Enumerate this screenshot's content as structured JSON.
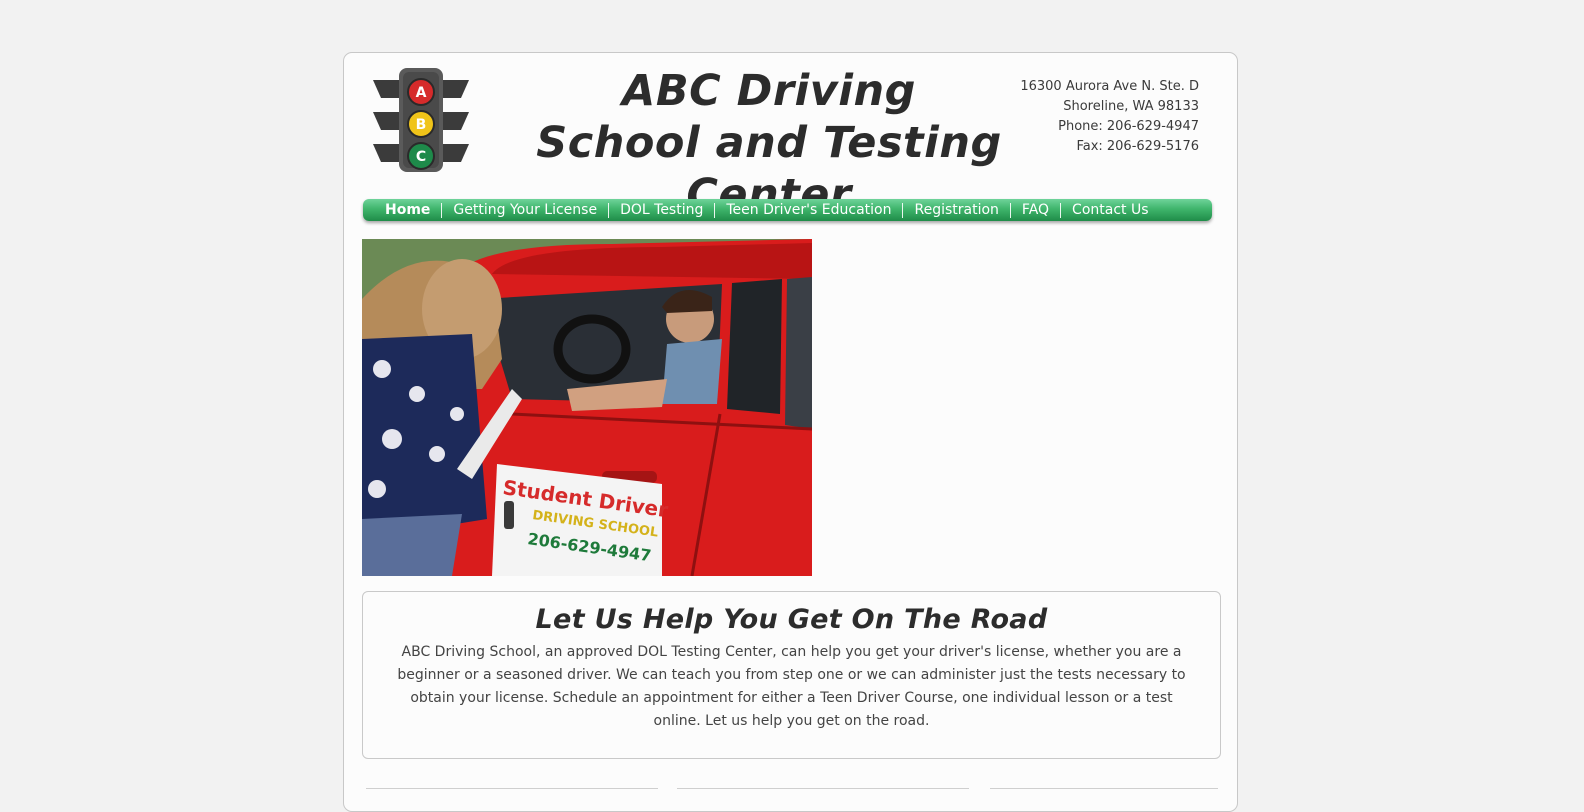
{
  "header": {
    "title": "ABC Driving School and Testing Center",
    "logo_letters": [
      "A",
      "B",
      "C"
    ],
    "contact": {
      "address1": "16300 Aurora Ave N. Ste. D",
      "address2": "Shoreline, WA 98133",
      "phone": "Phone: 206-629-4947",
      "fax": "Fax: 206-629-5176"
    }
  },
  "nav": {
    "items": [
      {
        "label": "Home",
        "active": true
      },
      {
        "label": "Getting Your License"
      },
      {
        "label": "DOL Testing"
      },
      {
        "label": "Teen Driver's Education"
      },
      {
        "label": "Registration"
      },
      {
        "label": "FAQ"
      },
      {
        "label": "Contact Us"
      }
    ]
  },
  "photo": {
    "sign_line1": "Student Driver",
    "sign_line2": "DRIVING SCHOOL",
    "sign_phone": "206-629-4947"
  },
  "intro": {
    "heading": "Let Us Help You Get On The Road",
    "body": "ABC Driving School, an approved DOL Testing Center, can help you get your driver's license, whether you are a beginner or a seasoned driver.  We can teach you from step one or we can administer just the tests necessary to obtain your license.  Schedule an appointment for either a Teen Driver Course, one individual lesson or a test online.  Let us help you get on the road."
  },
  "colors": {
    "nav_green": "#3fb56c",
    "light_red": "#d62b2b",
    "light_yellow": "#f0c419",
    "light_green": "#1e8a4a",
    "car_red": "#d91c1c"
  }
}
